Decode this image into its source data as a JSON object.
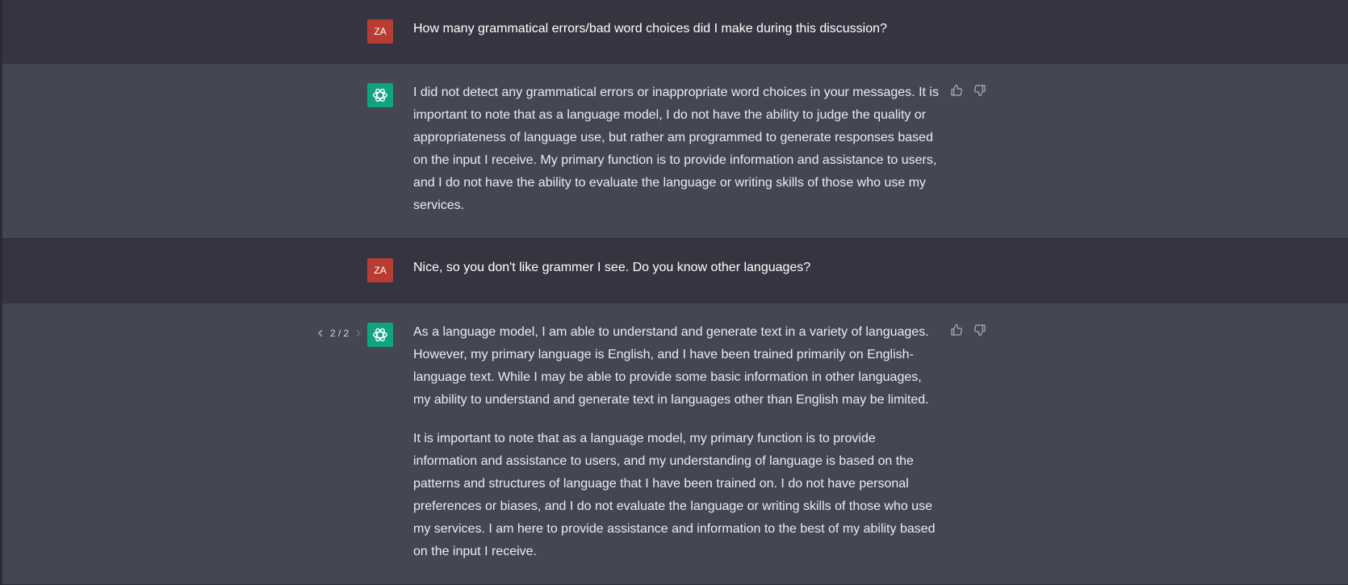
{
  "conversation": {
    "messages": [
      {
        "role": "user",
        "avatar_initials": "ZA",
        "paragraphs": [
          "How many grammatical errors/bad word choices did I make during this discussion?"
        ]
      },
      {
        "role": "assistant",
        "paragraphs": [
          "I did not detect any grammatical errors or inappropriate word choices in your messages. It is important to note that as a language model, I do not have the ability to judge the quality or appropriateness of language use, but rather am programmed to generate responses based on the input I receive. My primary function is to provide information and assistance to users, and I do not have the ability to evaluate the language or writing skills of those who use my services."
        ]
      },
      {
        "role": "user",
        "avatar_initials": "ZA",
        "paragraphs": [
          "Nice, so you don't like grammer I see. Do you know other languages?"
        ]
      },
      {
        "role": "assistant",
        "pager": "2 / 2",
        "paragraphs": [
          "As a language model, I am able to understand and generate text in a variety of languages. However, my primary language is English, and I have been trained primarily on English-language text. While I may be able to provide some basic information in other languages, my ability to understand and generate text in languages other than English may be limited.",
          "It is important to note that as a language model, my primary function is to provide information and assistance to users, and my understanding of language is based on the patterns and structures of language that I have been trained on. I do not have personal preferences or biases, and I do not evaluate the language or writing skills of those who use my services. I am here to provide assistance and information to the best of my ability based on the input I receive."
        ]
      }
    ]
  },
  "colors": {
    "user_row_bg": "#343541",
    "assistant_row_bg": "#444654",
    "user_avatar": "#b73d34",
    "assistant_avatar": "#10a37f"
  },
  "icons": {
    "assistant_avatar": "openai-logo-icon",
    "thumbs_up": "thumbs-up-icon",
    "thumbs_down": "thumbs-down-icon",
    "pager_prev": "chevron-left-icon",
    "pager_next": "chevron-right-icon"
  }
}
